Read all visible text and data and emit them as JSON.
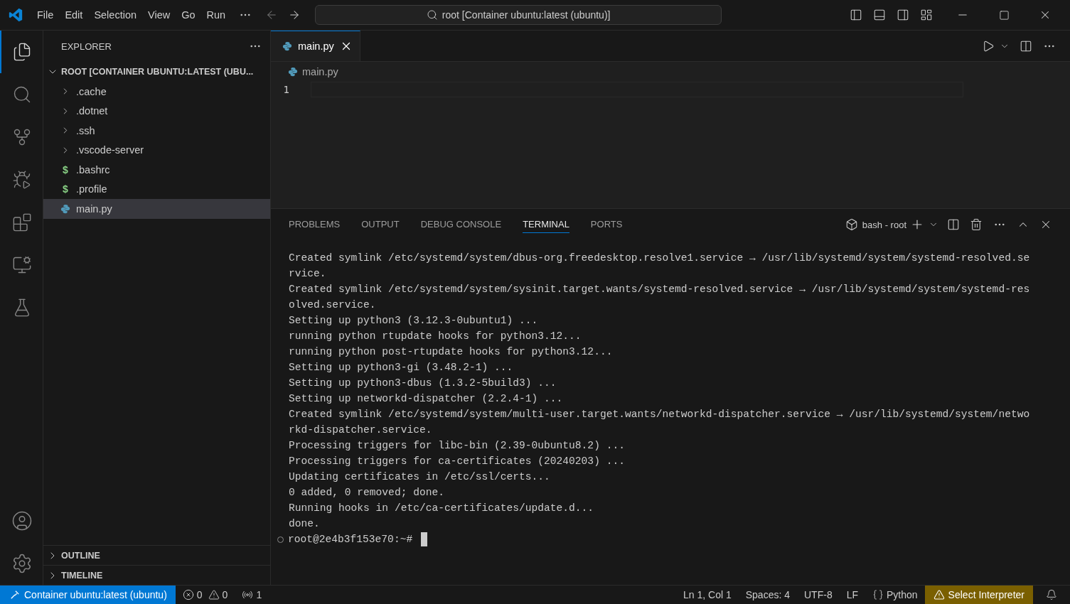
{
  "menu": [
    "File",
    "Edit",
    "Selection",
    "View",
    "Go",
    "Run"
  ],
  "command_center": "root [Container ubuntu:latest (ubuntu)]",
  "activity_bar": [
    {
      "kind": "explorer",
      "selected": true
    },
    {
      "kind": "search",
      "selected": false
    },
    {
      "kind": "source-control",
      "selected": false
    },
    {
      "kind": "run-debug",
      "selected": false
    },
    {
      "kind": "extensions",
      "selected": false
    },
    {
      "kind": "remote",
      "selected": false
    },
    {
      "kind": "testing",
      "selected": false
    }
  ],
  "sidebar": {
    "title": "EXPLORER",
    "root": {
      "label": "ROOT [CONTAINER UBUNTU:LATEST (UBU...",
      "expanded": true,
      "children": [
        {
          "label": ".cache",
          "kind": "folder",
          "expanded": false,
          "selected": false
        },
        {
          "label": ".dotnet",
          "kind": "folder",
          "expanded": false,
          "selected": false
        },
        {
          "label": ".ssh",
          "kind": "folder",
          "expanded": false,
          "selected": false
        },
        {
          "label": ".vscode-server",
          "kind": "folder",
          "expanded": false,
          "selected": false
        },
        {
          "label": ".bashrc",
          "kind": "shell",
          "icon": "$",
          "selected": false
        },
        {
          "label": ".profile",
          "kind": "shell",
          "icon": "$",
          "selected": false
        },
        {
          "label": "main.py",
          "kind": "python",
          "selected": true
        }
      ]
    },
    "sections": [
      {
        "label": "OUTLINE",
        "expanded": false
      },
      {
        "label": "TIMELINE",
        "expanded": false
      }
    ]
  },
  "editor": {
    "tabs": [
      {
        "label": "main.py",
        "selected": true
      }
    ],
    "breadcrumb": "main.py",
    "line_numbers": [
      "1"
    ]
  },
  "panel": {
    "tabs": [
      {
        "label": "PROBLEMS",
        "selected": false
      },
      {
        "label": "OUTPUT",
        "selected": false
      },
      {
        "label": "DEBUG CONSOLE",
        "selected": false
      },
      {
        "label": "TERMINAL",
        "selected": true
      },
      {
        "label": "PORTS",
        "selected": false
      }
    ],
    "terminal_name": "bash - root",
    "terminal_lines": [
      "Created symlink /etc/systemd/system/dbus-org.freedesktop.resolve1.service → /usr/lib/systemd/system/systemd-resolved.se",
      "rvice.",
      "Created symlink /etc/systemd/system/sysinit.target.wants/systemd-resolved.service → /usr/lib/systemd/system/systemd-res",
      "olved.service.",
      "Setting up python3 (3.12.3-0ubuntu1) ...",
      "running python rtupdate hooks for python3.12...",
      "running python post-rtupdate hooks for python3.12...",
      "Setting up python3-gi (3.48.2-1) ...",
      "Setting up python3-dbus (1.3.2-5build3) ...",
      "Setting up networkd-dispatcher (2.2.4-1) ...",
      "Created symlink /etc/systemd/system/multi-user.target.wants/networkd-dispatcher.service → /usr/lib/systemd/system/netwo",
      "rkd-dispatcher.service.",
      "Processing triggers for libc-bin (2.39-0ubuntu8.2) ...",
      "Processing triggers for ca-certificates (20240203) ...",
      "Updating certificates in /etc/ssl/certs...",
      "0 added, 0 removed; done.",
      "Running hooks in /etc/ca-certificates/update.d...",
      "done."
    ],
    "prompt": "root@2e4b3f153e70:~#"
  },
  "status_bar": {
    "remote": "Container ubuntu:latest (ubuntu)",
    "errors": "0",
    "warnings": "0",
    "ports": "1",
    "position": "Ln 1, Col 1",
    "indent": "Spaces: 4",
    "encoding": "UTF-8",
    "eol": "LF",
    "language": "Python",
    "interpreter": "Select Interpreter"
  }
}
